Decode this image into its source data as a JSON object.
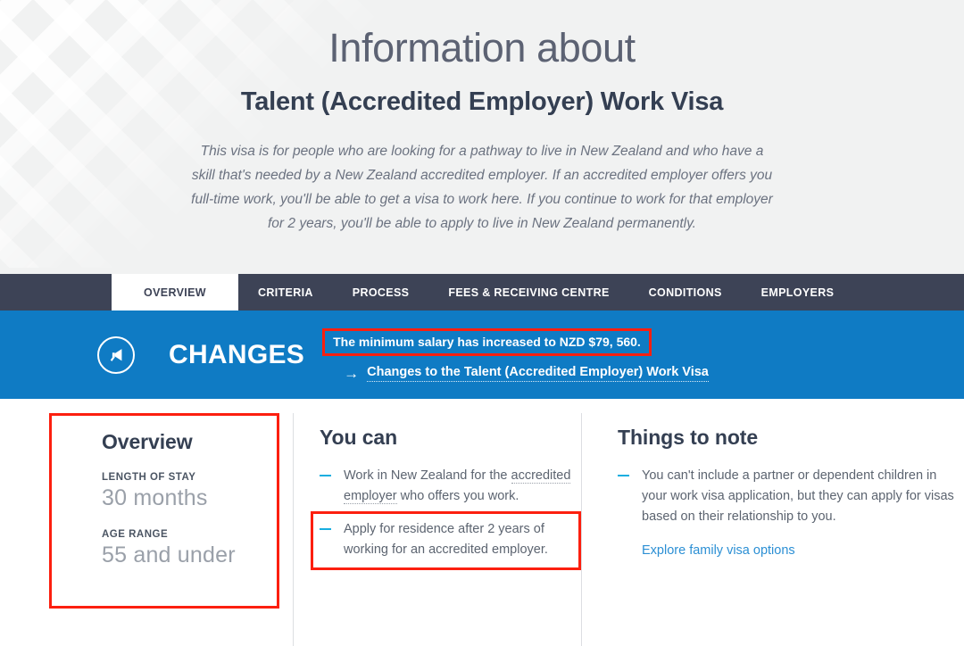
{
  "hero": {
    "eyebrow": "Information about",
    "title": "Talent (Accredited Employer) Work Visa",
    "description": "This visa is for people who are looking for a pathway to live in New Zealand and who have a skill that's needed by a New Zealand accredited employer. If an accredited employer offers you full-time work, you'll be able to get a visa to work here. If you continue to work for that employer for 2 years, you'll be able to apply to live in New Zealand permanently."
  },
  "tabs": [
    {
      "label": "OVERVIEW",
      "active": true
    },
    {
      "label": "CRITERIA",
      "active": false
    },
    {
      "label": "PROCESS",
      "active": false
    },
    {
      "label": "FEES & RECEIVING CENTRE",
      "active": false
    },
    {
      "label": "CONDITIONS",
      "active": false
    },
    {
      "label": "EMPLOYERS",
      "active": false
    }
  ],
  "banner": {
    "icon": "megaphone-icon",
    "label": "CHANGES",
    "headline": "The minimum salary has increased to NZD $79, 560.",
    "arrow": "→",
    "link": "Changes to the Talent (Accredited Employer) Work Visa",
    "background_color": "#0f7bc4",
    "highlight_color": "#fc1f0f"
  },
  "overview": {
    "heading": "Overview",
    "stats": [
      {
        "label": "LENGTH OF STAY",
        "value": "30 months"
      },
      {
        "label": "AGE RANGE",
        "value": "55 and under"
      }
    ],
    "highlighted": true
  },
  "you_can": {
    "heading": "You can",
    "items": [
      {
        "text_before": "Work in New Zealand for the ",
        "glossary_term": "accredited employer",
        "text_after": " who offers you work.",
        "highlighted": false
      },
      {
        "text_before": "Apply for residence after 2 years of working for an accredited employer.",
        "glossary_term": "",
        "text_after": "",
        "highlighted": true
      }
    ]
  },
  "things_to_note": {
    "heading": "Things to note",
    "items": [
      "You can't include a partner or dependent children in your work visa application, but they can apply for visas based on their relationship to you."
    ],
    "link": "Explore family visa options",
    "link_color": "#2b8fd4"
  }
}
